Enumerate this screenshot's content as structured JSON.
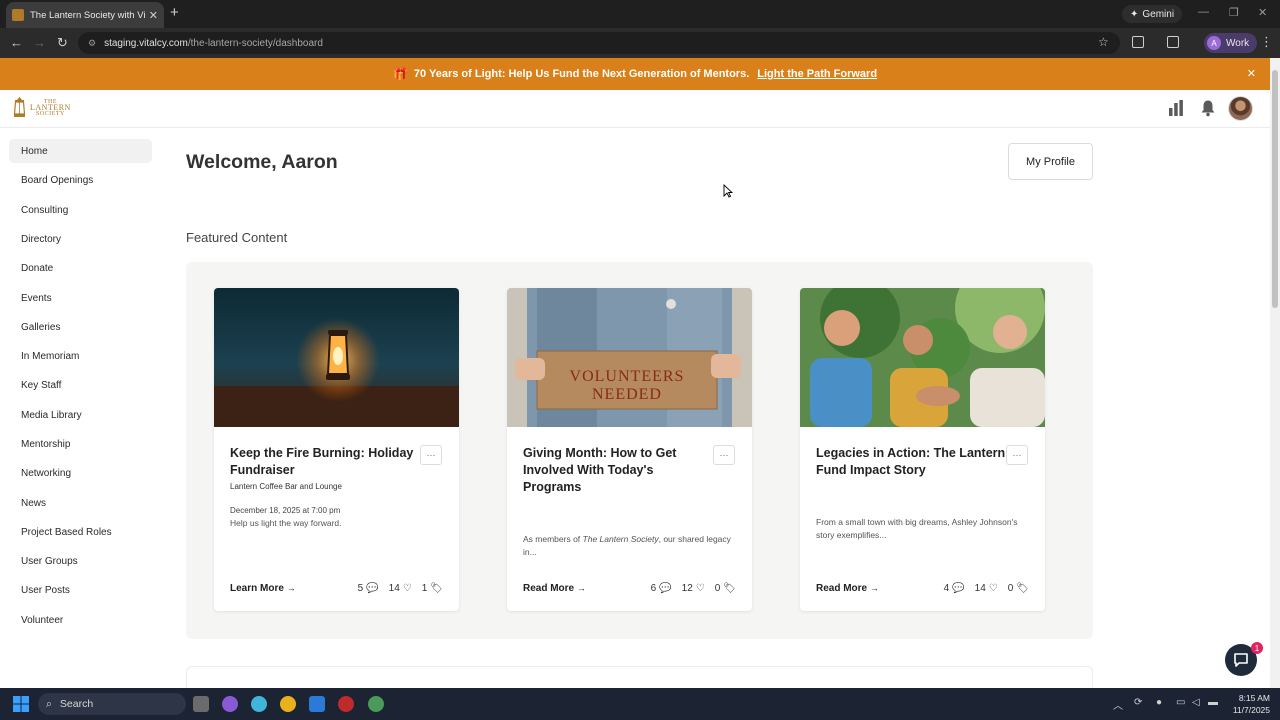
{
  "browser": {
    "tab_title": "The Lantern Society with Vitalcy",
    "new_tab": "+",
    "gemini_label": "Gemini",
    "url_host": "staging.vitalcy.com",
    "url_path": "/the-lantern-society/dashboard",
    "profile_initial": "A",
    "profile_label": "Work"
  },
  "promo": {
    "text": "70 Years of Light: Help Us Fund the Next Generation of Mentors.",
    "link": "Light the Path Forward"
  },
  "logo": {
    "small": "THE",
    "name": "LANTERN",
    "sub": "SOCIETY"
  },
  "sidebar": {
    "items": [
      {
        "label": "Home"
      },
      {
        "label": "Board Openings"
      },
      {
        "label": "Consulting"
      },
      {
        "label": "Directory"
      },
      {
        "label": "Donate"
      },
      {
        "label": "Events"
      },
      {
        "label": "Galleries"
      },
      {
        "label": "In Memoriam"
      },
      {
        "label": "Key Staff"
      },
      {
        "label": "Media Library"
      },
      {
        "label": "Mentorship"
      },
      {
        "label": "Networking"
      },
      {
        "label": "News"
      },
      {
        "label": "Project Based Roles"
      },
      {
        "label": "User Groups"
      },
      {
        "label": "User Posts"
      },
      {
        "label": "Volunteer"
      }
    ]
  },
  "main": {
    "welcome": "Welcome, Aaron",
    "profile_button": "My Profile",
    "featured_title": "Featured Content",
    "more_label": "···",
    "cards": [
      {
        "title": "Keep the Fire Burning: Holiday Fundraiser",
        "location": "Lantern Coffee Bar and Lounge",
        "date": "December 18, 2025 at 7:00 pm",
        "desc": "Help us light the way forward.",
        "action": "Learn More",
        "comments": "5",
        "likes": "14",
        "tags": "1"
      },
      {
        "title": "Giving Month: How to Get Involved With Today's Programs",
        "desc_pre": "As members of ",
        "desc_em": "The Lantern Society",
        "desc_post": ", our shared legacy in...",
        "action": "Read More",
        "comments": "6",
        "likes": "12",
        "tags": "0"
      },
      {
        "title": "Legacies in Action: The Lantern Fund Impact Story",
        "desc": "From a small town with big dreams, Ashley Johnson's story exemplifies...",
        "action": "Read More",
        "comments": "4",
        "likes": "14",
        "tags": "0"
      }
    ],
    "card2_image_text": "VOLUNTEERS NEEDED"
  },
  "chat_badge": "1",
  "taskbar": {
    "search": "Search",
    "time": "8:15 AM",
    "date": "11/7/2025"
  },
  "colors": {
    "promo": "#d9801a",
    "brand": "#b07a2a",
    "chat": "#1f2a3a"
  }
}
